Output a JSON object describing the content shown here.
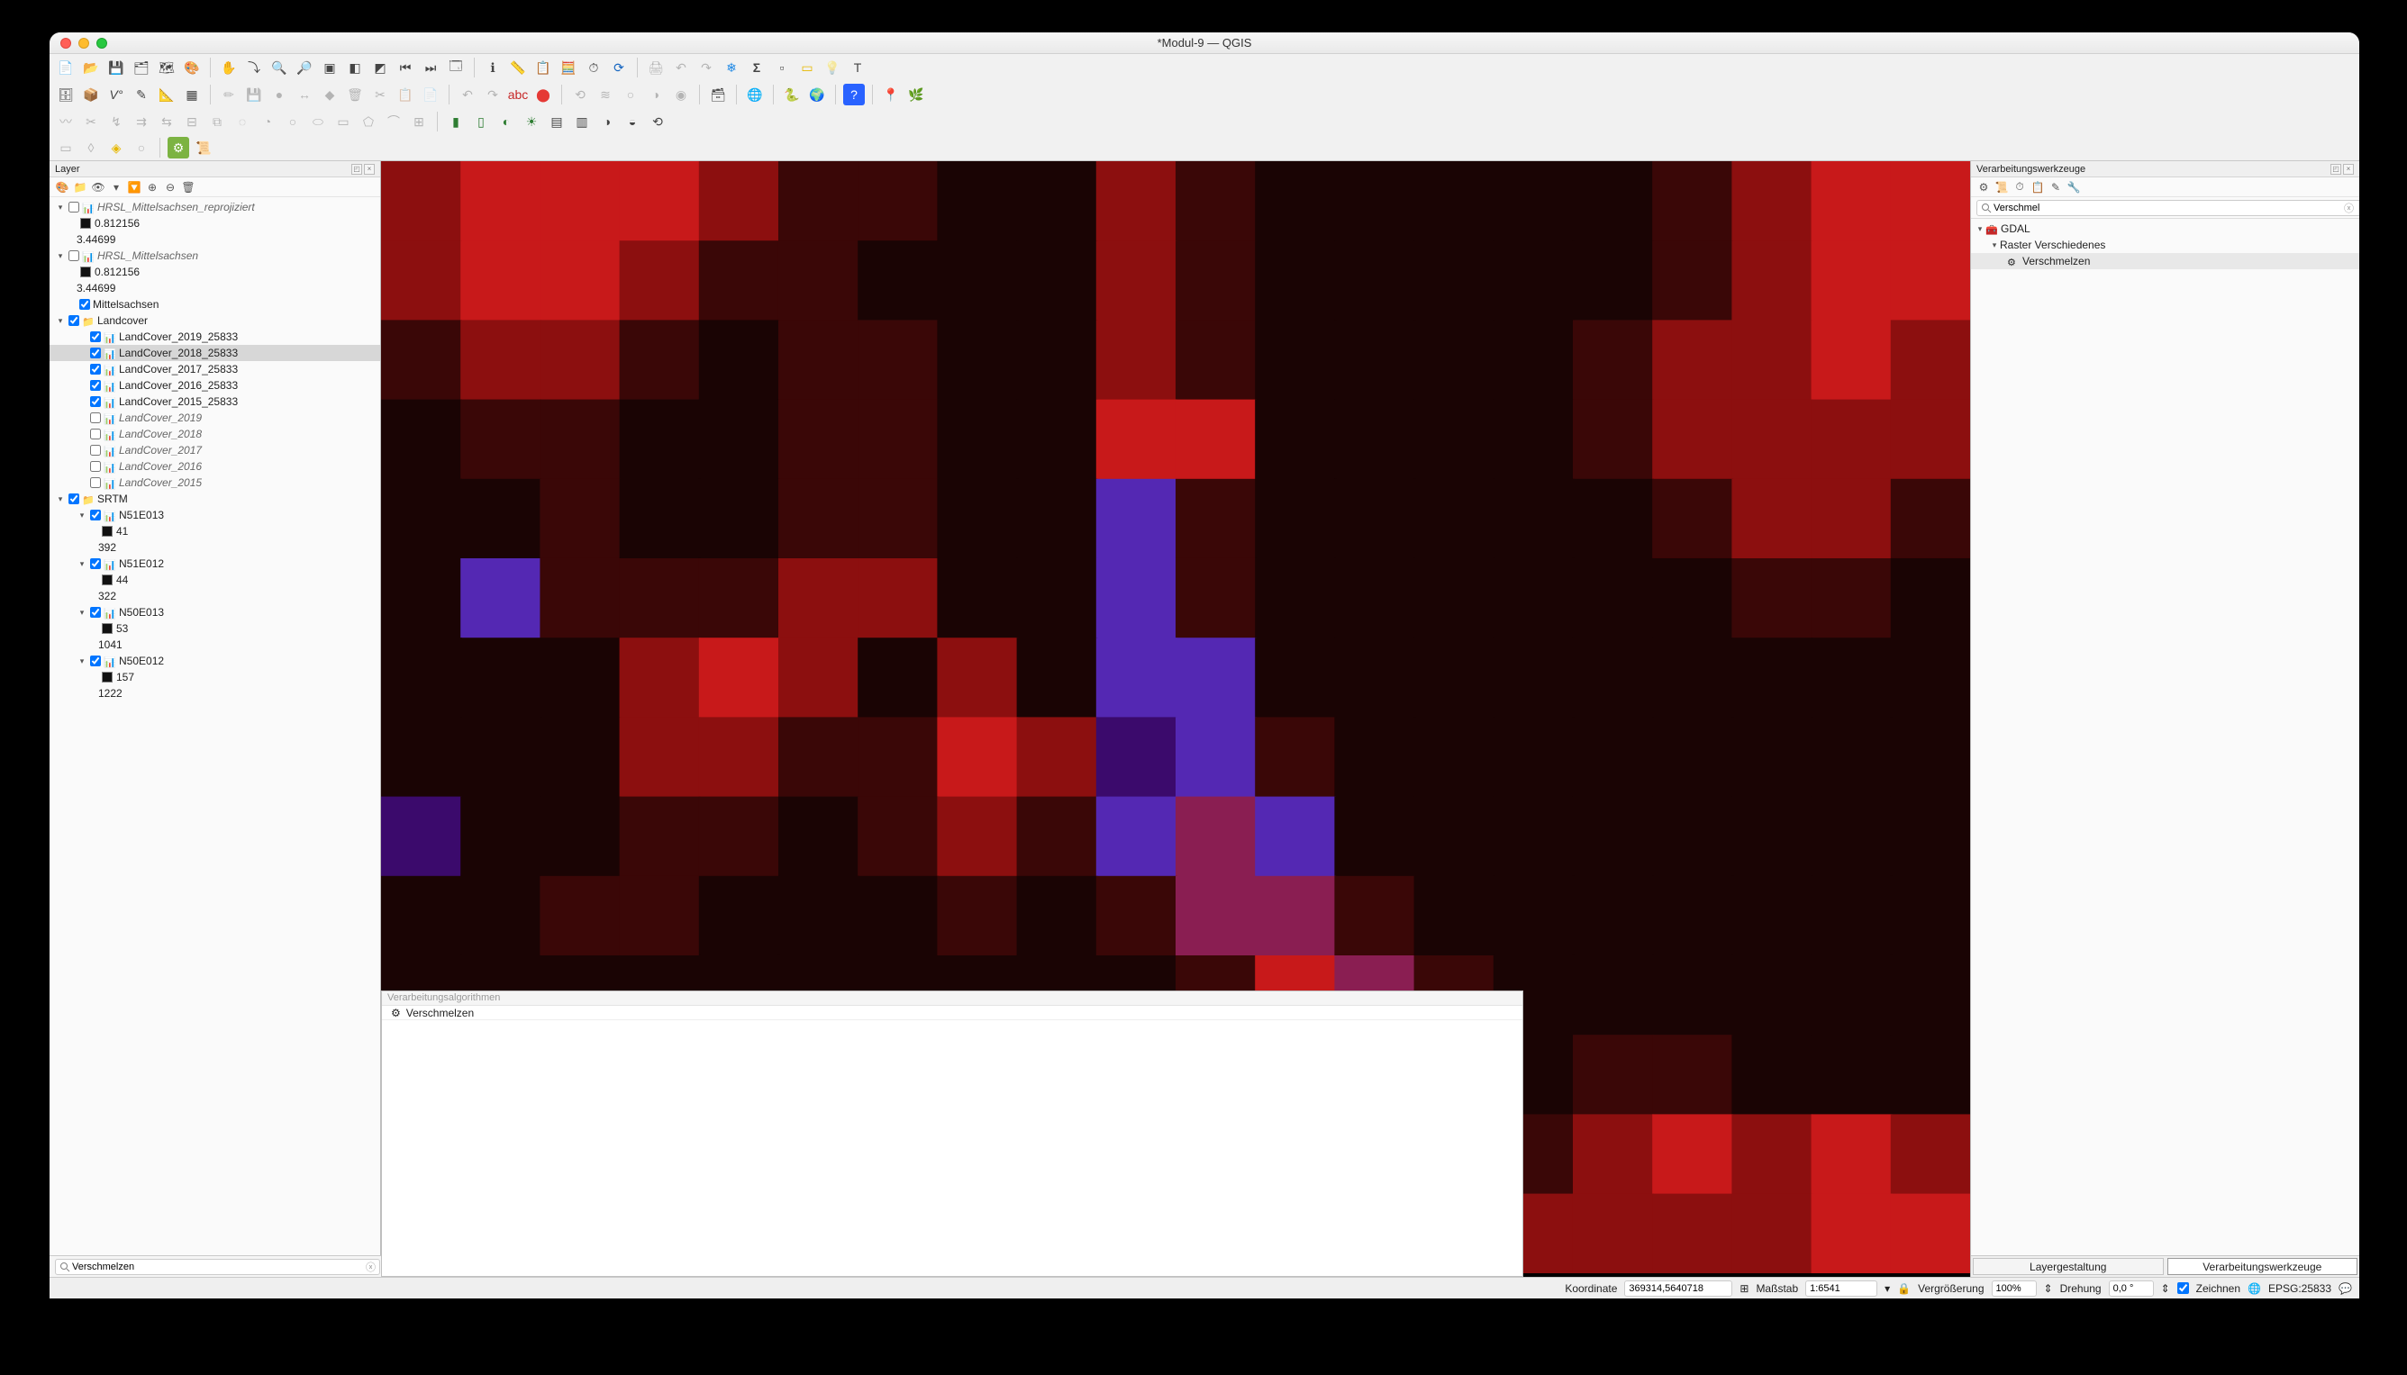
{
  "window": {
    "title": "*Modul-9 — QGIS"
  },
  "panels": {
    "layers_title": "Layer",
    "processing_title": "Verarbeitungswerkzeuge",
    "results_title": "Verarbeitungsalgorithmen",
    "results_row": "Verschmelzen"
  },
  "search": {
    "processing_value": "Verschmel",
    "locator_value": "Verschmelzen"
  },
  "processing_tree": {
    "root": "GDAL",
    "sub": "Raster Verschiedenes",
    "leaf": "Verschmelzen"
  },
  "right_tabs": {
    "left": "Layergestaltung",
    "right": "Verarbeitungswerkzeuge"
  },
  "status": {
    "coord_label": "Koordinate",
    "coord_value": "369314,5640718",
    "scale_label": "Maßstab",
    "scale_value": "1:6541",
    "mag_label": "Vergrößerung",
    "mag_value": "100%",
    "rotation_label": "Drehung",
    "rotation_value": "0,0 °",
    "render_label": "Zeichnen",
    "crs": "EPSG:25833"
  },
  "layers": [
    {
      "type": "group",
      "exp": "▾",
      "check": false,
      "icon": "📊",
      "label": "HRSL_Mittelsachsen_reprojiziert",
      "italic": true,
      "indent": 0
    },
    {
      "type": "val",
      "swatch": true,
      "label": "0.812156",
      "indent": 2
    },
    {
      "type": "val",
      "label": "3.44699",
      "indent": 2
    },
    {
      "type": "group",
      "exp": "▾",
      "check": false,
      "icon": "📊",
      "label": "HRSL_Mittelsachsen",
      "italic": true,
      "indent": 0
    },
    {
      "type": "val",
      "swatch": true,
      "label": "0.812156",
      "indent": 2
    },
    {
      "type": "val",
      "label": "3.44699",
      "indent": 2
    },
    {
      "type": "layer",
      "check": true,
      "label": "Mittelsachsen",
      "indent": 1
    },
    {
      "type": "group",
      "exp": "▾",
      "check": true,
      "icon": "📁",
      "label": "Landcover",
      "indent": 0
    },
    {
      "type": "layer",
      "check": true,
      "icon": "📊",
      "label": "LandCover_2019_25833",
      "indent": 2
    },
    {
      "type": "layer",
      "check": true,
      "icon": "📊",
      "label": "LandCover_2018_25833",
      "indent": 2,
      "sel": true
    },
    {
      "type": "layer",
      "check": true,
      "icon": "📊",
      "label": "LandCover_2017_25833",
      "indent": 2
    },
    {
      "type": "layer",
      "check": true,
      "icon": "📊",
      "label": "LandCover_2016_25833",
      "indent": 2
    },
    {
      "type": "layer",
      "check": true,
      "icon": "📊",
      "label": "LandCover_2015_25833",
      "indent": 2
    },
    {
      "type": "layer",
      "check": false,
      "icon": "📊",
      "label": "LandCover_2019",
      "italic": true,
      "indent": 2
    },
    {
      "type": "layer",
      "check": false,
      "icon": "📊",
      "label": "LandCover_2018",
      "italic": true,
      "indent": 2
    },
    {
      "type": "layer",
      "check": false,
      "icon": "📊",
      "label": "LandCover_2017",
      "italic": true,
      "indent": 2
    },
    {
      "type": "layer",
      "check": false,
      "icon": "📊",
      "label": "LandCover_2016",
      "italic": true,
      "indent": 2
    },
    {
      "type": "layer",
      "check": false,
      "icon": "📊",
      "label": "LandCover_2015",
      "italic": true,
      "indent": 2
    },
    {
      "type": "group",
      "exp": "▾",
      "check": true,
      "icon": "📁",
      "label": "SRTM",
      "indent": 0
    },
    {
      "type": "group",
      "exp": "▾",
      "check": true,
      "icon": "📊",
      "label": "N51E013",
      "indent": 2
    },
    {
      "type": "val",
      "swatch": true,
      "label": "41",
      "indent": 4
    },
    {
      "type": "val",
      "label": "392",
      "indent": 4
    },
    {
      "type": "group",
      "exp": "▾",
      "check": true,
      "icon": "📊",
      "label": "N51E012",
      "indent": 2
    },
    {
      "type": "val",
      "swatch": true,
      "label": "44",
      "indent": 4
    },
    {
      "type": "val",
      "label": "322",
      "indent": 4
    },
    {
      "type": "group",
      "exp": "▾",
      "check": true,
      "icon": "📊",
      "label": "N50E013",
      "indent": 2
    },
    {
      "type": "val",
      "swatch": true,
      "label": "53",
      "indent": 4
    },
    {
      "type": "val",
      "label": "1041",
      "indent": 4
    },
    {
      "type": "group",
      "exp": "▾",
      "check": true,
      "icon": "📊",
      "label": "N50E012",
      "indent": 2
    },
    {
      "type": "val",
      "swatch": true,
      "label": "157",
      "indent": 4
    },
    {
      "type": "val",
      "label": "1222",
      "indent": 4
    }
  ],
  "chart_data": {
    "type": "heatmap",
    "note": "Blocky RGB raster of LandCover imagery rendered in red-on-black with blue/purple highlights along a diagonal river; approximate cell colors on a 20x14 grid.",
    "cols": 20,
    "rows": 14,
    "palette": {
      "0": "#1a0404",
      "1": "#3a0707",
      "2": "#8c0f0f",
      "3": "#c8191a",
      "4": "#3b0a6c",
      "5": "#5428b3",
      "6": "#8a1e52",
      "7": "#000000"
    },
    "grid": [
      [
        2,
        3,
        3,
        3,
        2,
        1,
        1,
        0,
        0,
        2,
        1,
        0,
        0,
        0,
        0,
        0,
        1,
        2,
        3,
        3
      ],
      [
        2,
        3,
        3,
        2,
        1,
        1,
        0,
        0,
        0,
        2,
        1,
        0,
        0,
        0,
        0,
        0,
        1,
        2,
        3,
        3
      ],
      [
        1,
        2,
        2,
        1,
        0,
        1,
        1,
        0,
        0,
        2,
        1,
        0,
        0,
        0,
        0,
        1,
        2,
        2,
        3,
        2
      ],
      [
        0,
        1,
        1,
        0,
        0,
        1,
        1,
        0,
        0,
        3,
        3,
        0,
        0,
        0,
        0,
        1,
        2,
        2,
        2,
        2
      ],
      [
        0,
        0,
        1,
        0,
        0,
        1,
        1,
        0,
        0,
        5,
        1,
        0,
        0,
        0,
        0,
        0,
        1,
        2,
        2,
        1
      ],
      [
        0,
        5,
        1,
        1,
        1,
        2,
        2,
        0,
        0,
        5,
        1,
        0,
        0,
        0,
        0,
        0,
        0,
        1,
        1,
        0
      ],
      [
        0,
        0,
        0,
        2,
        3,
        2,
        0,
        2,
        0,
        5,
        5,
        0,
        0,
        0,
        0,
        0,
        0,
        0,
        0,
        0
      ],
      [
        0,
        0,
        0,
        2,
        2,
        1,
        1,
        3,
        2,
        4,
        5,
        1,
        0,
        0,
        0,
        0,
        0,
        0,
        0,
        0
      ],
      [
        4,
        0,
        0,
        1,
        1,
        0,
        1,
        2,
        1,
        5,
        6,
        5,
        0,
        0,
        0,
        0,
        0,
        0,
        0,
        0
      ],
      [
        0,
        0,
        1,
        1,
        0,
        0,
        0,
        1,
        0,
        1,
        6,
        6,
        1,
        0,
        0,
        0,
        0,
        0,
        0,
        0
      ],
      [
        0,
        0,
        0,
        0,
        0,
        0,
        0,
        0,
        0,
        0,
        1,
        3,
        6,
        1,
        0,
        0,
        0,
        0,
        0,
        0
      ],
      [
        7,
        7,
        7,
        7,
        7,
        7,
        7,
        7,
        7,
        7,
        0,
        1,
        3,
        1,
        0,
        1,
        1,
        0,
        0,
        0
      ],
      [
        7,
        7,
        7,
        7,
        7,
        7,
        7,
        7,
        7,
        7,
        0,
        0,
        1,
        1,
        1,
        2,
        3,
        2,
        3,
        2
      ],
      [
        7,
        7,
        7,
        7,
        7,
        7,
        7,
        7,
        7,
        7,
        0,
        0,
        0,
        1,
        2,
        2,
        2,
        2,
        3,
        3
      ]
    ]
  }
}
